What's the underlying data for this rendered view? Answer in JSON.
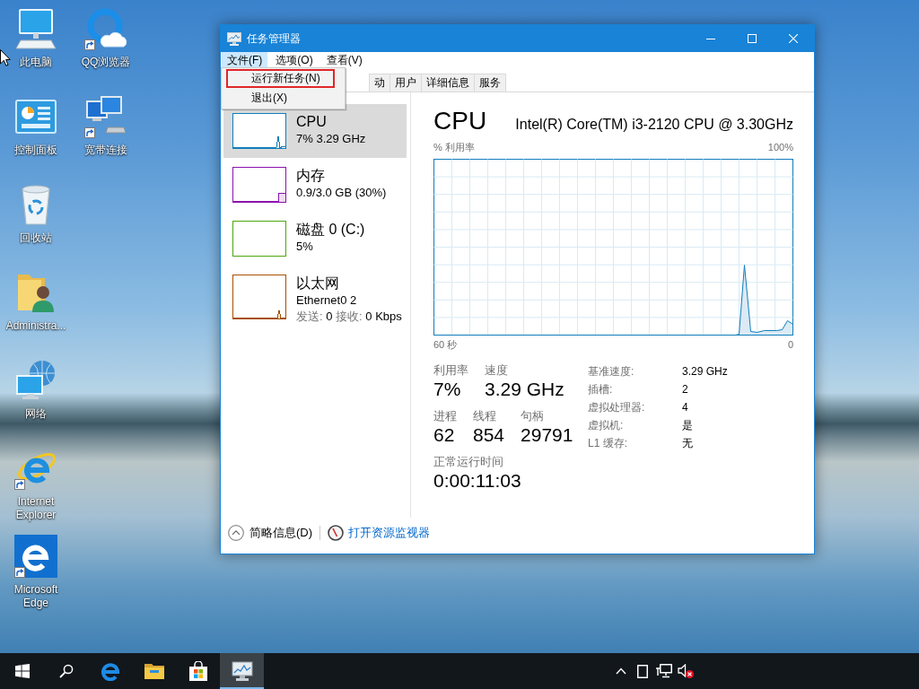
{
  "desktop": {
    "icons": [
      {
        "label": "此电脑",
        "kind": "computer",
        "shortcut": false
      },
      {
        "label": "控制面板",
        "kind": "control-panel",
        "shortcut": false
      },
      {
        "label": "回收站",
        "kind": "recycle-bin",
        "shortcut": false
      },
      {
        "label": "Administra...",
        "kind": "user-folder",
        "shortcut": false
      },
      {
        "label": "网络",
        "kind": "network",
        "shortcut": false
      },
      {
        "label": "Internet Explorer",
        "kind": "ie",
        "shortcut": true
      },
      {
        "label": "Microsoft Edge",
        "kind": "edge",
        "shortcut": true
      },
      {
        "label": "QQ浏览器",
        "kind": "qq-browser",
        "shortcut": true
      },
      {
        "label": "宽带连接",
        "kind": "broadband",
        "shortcut": true
      }
    ]
  },
  "window": {
    "title": "任务管理器",
    "menu": [
      {
        "label": "文件(F)",
        "selected": true
      },
      {
        "label": "选项(O)",
        "selected": false
      },
      {
        "label": "查看(V)",
        "selected": false
      }
    ],
    "file_menu": [
      {
        "label": "运行新任务(N)",
        "highlighted": true
      },
      {
        "label": "退出(X)",
        "highlighted": false
      }
    ],
    "tabs": [
      {
        "label": "动",
        "selected": false
      },
      {
        "label": "用户",
        "selected": false
      },
      {
        "label": "详细信息",
        "selected": false
      },
      {
        "label": "服务",
        "selected": false
      }
    ],
    "sidebar": [
      {
        "kind": "cpu",
        "title": "CPU",
        "subtitle": "7% 3.29 GHz",
        "color": "#117dbb",
        "selected": true
      },
      {
        "kind": "memory",
        "title": "内存",
        "subtitle": "0.9/3.0 GB (30%)",
        "color": "#8b12ae",
        "selected": false
      },
      {
        "kind": "disk",
        "title": "磁盘 0 (C:)",
        "subtitle": "5%",
        "color": "#4da60c",
        "selected": false
      },
      {
        "kind": "network",
        "title": "以太网",
        "subtitle": "Ethernet0 2",
        "stats": [
          {
            "label": "发送:",
            "value": "0"
          },
          {
            "label": "接收:",
            "value": "0 Kbps"
          }
        ],
        "color": "#a74f01",
        "selected": false
      }
    ],
    "detail": {
      "title": "CPU",
      "model": "Intel(R) Core(TM) i3-2120 CPU @ 3.30GHz",
      "graph": {
        "caption": "% 利用率",
        "max_label": "100%",
        "start_label": "60 秒",
        "end_label": "0"
      },
      "stat_rows": [
        [
          {
            "label": "利用率",
            "value": "7%"
          },
          {
            "label": "速度",
            "value": "3.29 GHz"
          }
        ],
        [
          {
            "label": "进程",
            "value": "62"
          },
          {
            "label": "线程",
            "value": "854"
          },
          {
            "label": "句柄",
            "value": "29791"
          }
        ],
        [
          {
            "label": "正常运行时间",
            "value": "0:00:11:03"
          }
        ]
      ],
      "specs": [
        {
          "label": "基准速度:",
          "value": "3.29 GHz"
        },
        {
          "label": "插槽:",
          "value": "2"
        },
        {
          "label": "虚拟处理器:",
          "value": "4"
        },
        {
          "label": "虚拟机:",
          "value": "是"
        },
        {
          "label": "L1 缓存:",
          "value": "无"
        }
      ]
    },
    "footer": {
      "toggle": "简略信息(D)",
      "link": "打开资源监视器"
    }
  },
  "taskbar": {
    "buttons": [
      {
        "kind": "start",
        "active": false
      },
      {
        "kind": "search",
        "active": false
      },
      {
        "kind": "edge",
        "active": false
      },
      {
        "kind": "explorer",
        "active": false
      },
      {
        "kind": "store",
        "active": false
      },
      {
        "kind": "task-manager",
        "active": true
      }
    ],
    "tray": [
      {
        "kind": "chevron"
      },
      {
        "kind": "tablet"
      },
      {
        "kind": "network"
      },
      {
        "kind": "volume-error"
      }
    ]
  }
}
